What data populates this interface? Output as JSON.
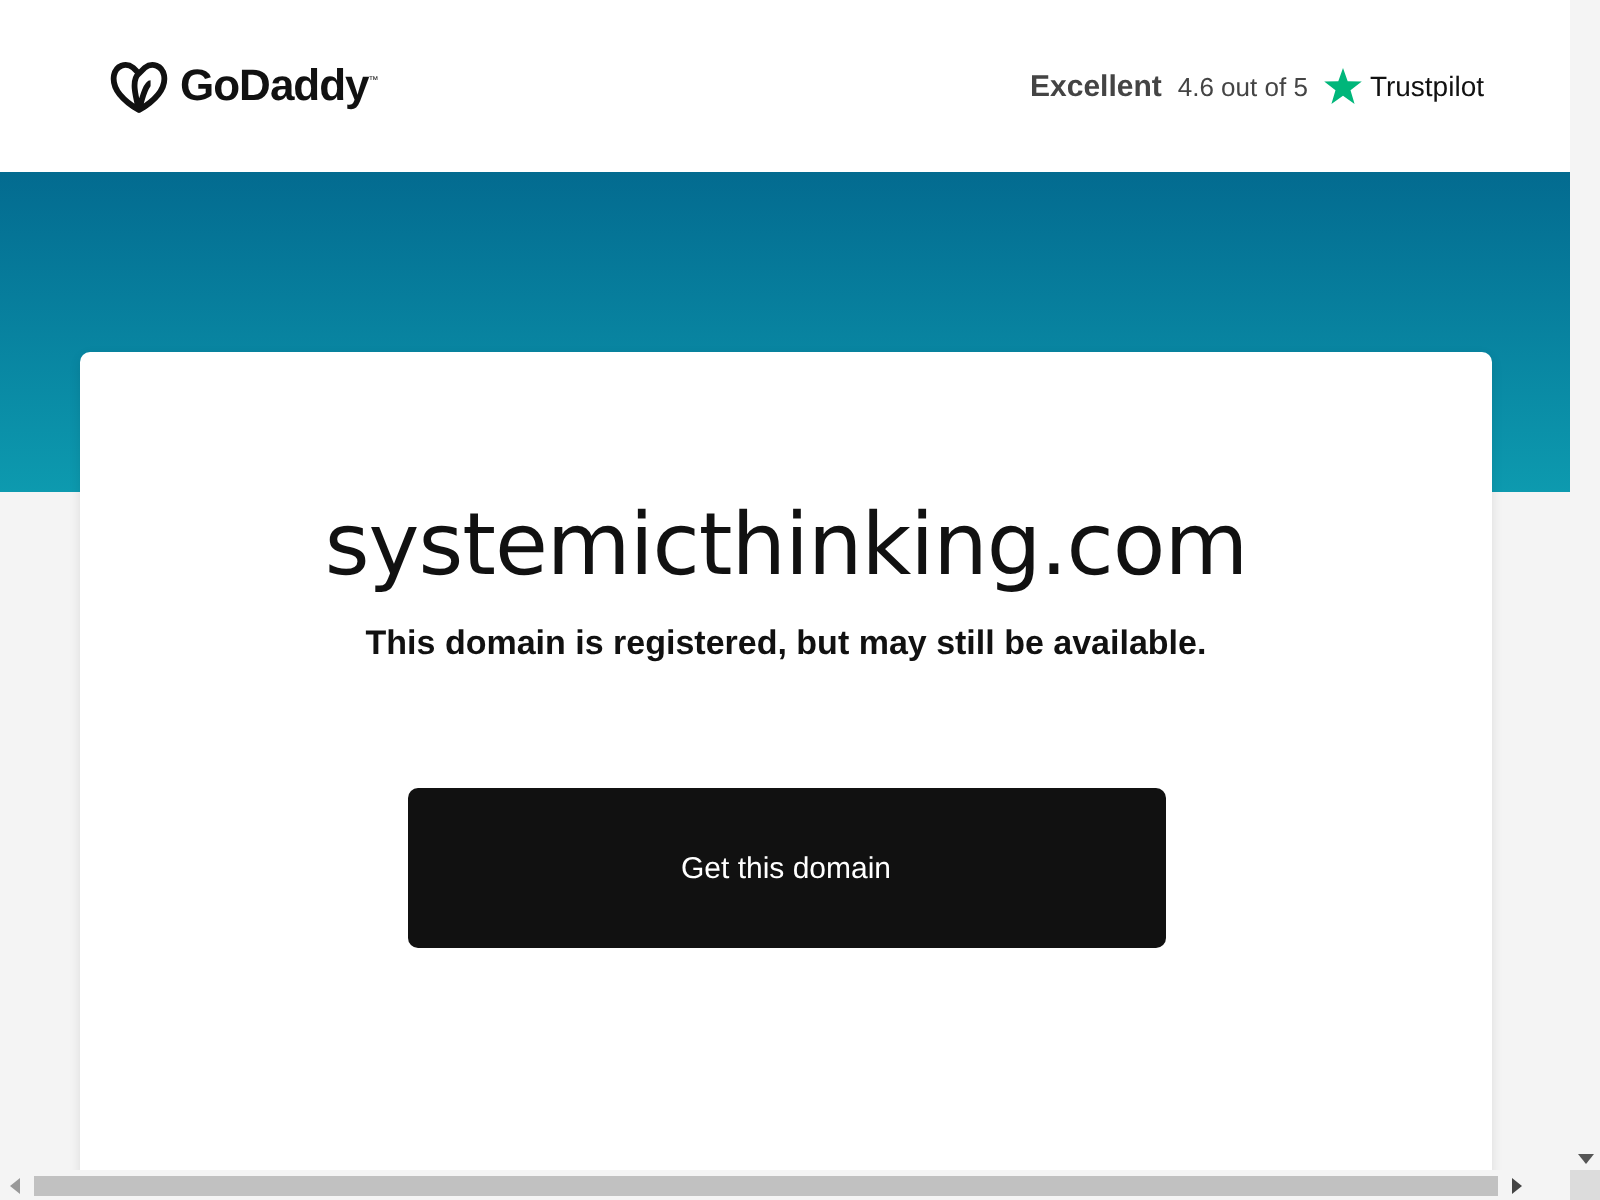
{
  "header": {
    "logo": "GoDaddy$^{™}$",
    "rating": {
      "label": "Excellent",
      "score": "4.6 out of 5",
      "brand": "Trustpilot"
    }
  },
  "card": {
    "domain": "systemicthinking.com",
    "message": "This domain is registered, but may still be available.",
    "button": "Get this domain"
  }
}
